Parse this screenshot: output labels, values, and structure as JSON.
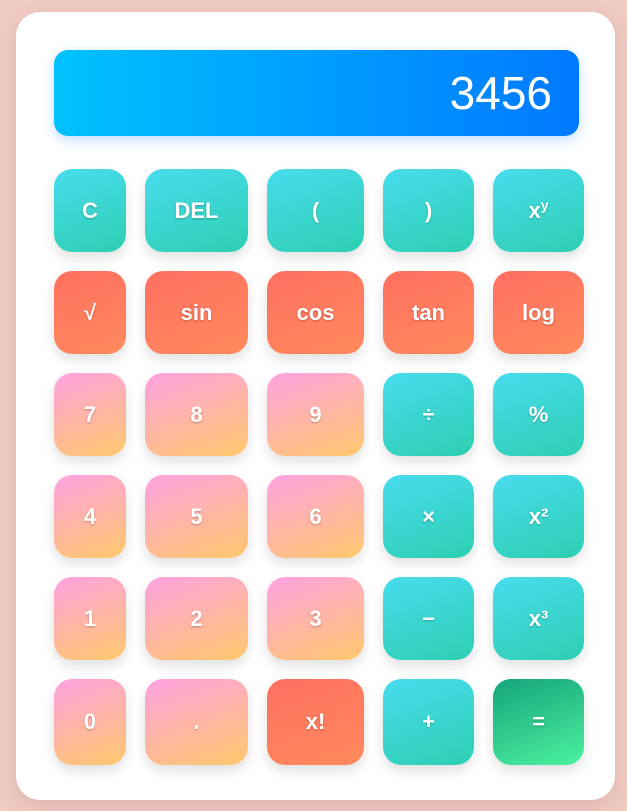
{
  "display": {
    "value": "3456"
  },
  "keys": [
    [
      {
        "name": "clear-button",
        "label": "C",
        "style": "teal"
      },
      {
        "name": "delete-button",
        "label": "DEL",
        "style": "teal"
      },
      {
        "name": "open-paren-button",
        "label": "(",
        "style": "teal"
      },
      {
        "name": "close-paren-button",
        "label": ")",
        "style": "teal"
      },
      {
        "name": "power-button",
        "label": "x",
        "sup": "y",
        "style": "teal"
      }
    ],
    [
      {
        "name": "sqrt-button",
        "label": "√",
        "style": "coral"
      },
      {
        "name": "sin-button",
        "label": "sin",
        "style": "coral"
      },
      {
        "name": "cos-button",
        "label": "cos",
        "style": "coral"
      },
      {
        "name": "tan-button",
        "label": "tan",
        "style": "coral"
      },
      {
        "name": "log-button",
        "label": "log",
        "style": "coral"
      }
    ],
    [
      {
        "name": "digit-7-button",
        "label": "7",
        "style": "pink"
      },
      {
        "name": "digit-8-button",
        "label": "8",
        "style": "pink"
      },
      {
        "name": "digit-9-button",
        "label": "9",
        "style": "pink"
      },
      {
        "name": "divide-button",
        "label": "÷",
        "style": "teal"
      },
      {
        "name": "percent-button",
        "label": "%",
        "style": "teal"
      }
    ],
    [
      {
        "name": "digit-4-button",
        "label": "4",
        "style": "pink"
      },
      {
        "name": "digit-5-button",
        "label": "5",
        "style": "pink"
      },
      {
        "name": "digit-6-button",
        "label": "6",
        "style": "pink"
      },
      {
        "name": "multiply-button",
        "label": "×",
        "style": "teal"
      },
      {
        "name": "square-button",
        "label": "x²",
        "style": "teal"
      }
    ],
    [
      {
        "name": "digit-1-button",
        "label": "1",
        "style": "pink"
      },
      {
        "name": "digit-2-button",
        "label": "2",
        "style": "pink"
      },
      {
        "name": "digit-3-button",
        "label": "3",
        "style": "pink"
      },
      {
        "name": "subtract-button",
        "label": "−",
        "style": "teal"
      },
      {
        "name": "cube-button",
        "label": "x³",
        "style": "teal"
      }
    ],
    [
      {
        "name": "digit-0-button",
        "label": "0",
        "style": "pink"
      },
      {
        "name": "decimal-button",
        "label": ".",
        "style": "pink"
      },
      {
        "name": "factorial-button",
        "label": "x!",
        "style": "coral"
      },
      {
        "name": "add-button",
        "label": "+",
        "style": "teal"
      },
      {
        "name": "equals-button",
        "label": "=",
        "style": "green"
      }
    ]
  ]
}
